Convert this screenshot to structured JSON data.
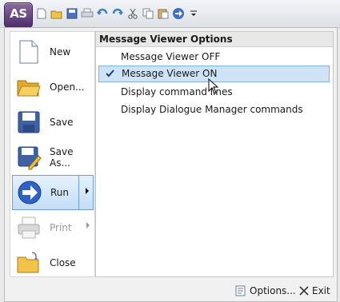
{
  "app": {
    "logo_text": "AS",
    "logo_color": "#5b3a78"
  },
  "quick_access": [
    {
      "icon": "new-doc-icon"
    },
    {
      "icon": "open-folder-icon"
    },
    {
      "icon": "save-icon"
    },
    {
      "icon": "print-icon"
    },
    {
      "icon": "undo-icon"
    },
    {
      "icon": "redo-icon"
    },
    {
      "icon": "cut-icon"
    },
    {
      "icon": "copy-icon"
    },
    {
      "icon": "paste-icon"
    },
    {
      "icon": "run-icon"
    },
    {
      "icon": "customize-dropdown-icon"
    }
  ],
  "menu": {
    "items": [
      {
        "label": "New",
        "icon": "new-doc-icon"
      },
      {
        "label": "Open...",
        "icon": "open-folder-icon"
      },
      {
        "label": "Save",
        "icon": "save-disk-icon"
      },
      {
        "label": "Save As...",
        "icon": "save-as-icon"
      },
      {
        "label": "Run",
        "icon": "run-arrow-icon",
        "active": true
      },
      {
        "label": "Print",
        "icon": "printer-icon",
        "disabled": true
      },
      {
        "label": "Close",
        "icon": "close-folder-icon"
      }
    ]
  },
  "submenu": {
    "title": "Message Viewer Options",
    "items": [
      {
        "label": "Message Viewer OFF",
        "checked": false
      },
      {
        "label": "Message Viewer ON",
        "checked": true
      },
      {
        "label": "Display command lines",
        "checked": false
      },
      {
        "label": "Display Dialogue Manager commands",
        "checked": false
      }
    ]
  },
  "footer": {
    "options_label": "Options...",
    "exit_label": "Exit"
  },
  "colors": {
    "highlight": "#cfe3f8",
    "highlight_border": "#84b2e1",
    "active_border": "#6f9ed3"
  }
}
